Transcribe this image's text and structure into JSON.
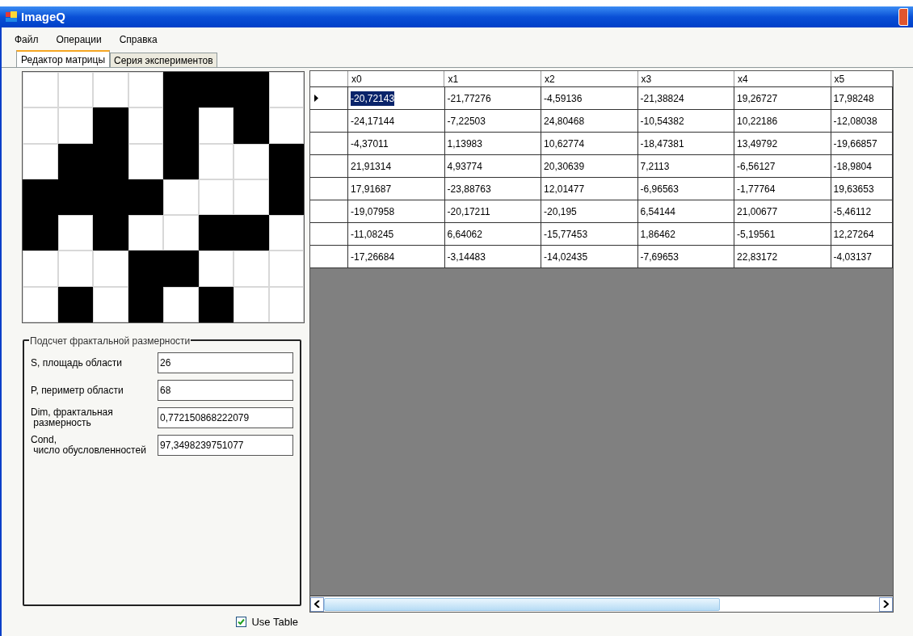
{
  "window": {
    "title": "ImageQ"
  },
  "menu": [
    "Файл",
    "Операции",
    "Справка"
  ],
  "tabs": [
    {
      "label": "Редактор матрицы",
      "selected": true
    },
    {
      "label": "Серия экспериментов",
      "selected": false
    }
  ],
  "matrix": [
    [
      false,
      false,
      false,
      false,
      true,
      true,
      true,
      false
    ],
    [
      false,
      false,
      true,
      false,
      true,
      false,
      true,
      false
    ],
    [
      false,
      true,
      true,
      false,
      true,
      false,
      false,
      true
    ],
    [
      true,
      true,
      true,
      true,
      false,
      false,
      false,
      true
    ],
    [
      true,
      false,
      true,
      false,
      false,
      true,
      true,
      false
    ],
    [
      false,
      false,
      false,
      true,
      true,
      false,
      false,
      false
    ],
    [
      false,
      true,
      false,
      true,
      false,
      true,
      false,
      false
    ]
  ],
  "group": {
    "title": "Подсчет фрактальной размерности",
    "fields": [
      {
        "label": "S, площадь области",
        "value": "26"
      },
      {
        "label": "P, периметр области",
        "value": "68"
      },
      {
        "label": "Dim, фрактальная\n размерность",
        "value": "0,772150868222079"
      },
      {
        "label": "Cond,\n число обусловленностей",
        "value": "97,3498239751077"
      }
    ]
  },
  "use_table": {
    "label": "Use Table",
    "checked": true
  },
  "table": {
    "columns": [
      "x0",
      "x1",
      "x2",
      "x3",
      "x4",
      "x5"
    ],
    "rows": [
      {
        "selected": true,
        "cells": [
          "-20,72143",
          "-21,77276",
          "-4,59136",
          "-21,38824",
          "19,26727",
          "17,98248"
        ]
      },
      {
        "selected": false,
        "cells": [
          "-24,17144",
          "-7,22503",
          "24,80468",
          "-10,54382",
          "10,22186",
          "-12,08038"
        ]
      },
      {
        "selected": false,
        "cells": [
          "-4,37011",
          "1,13983",
          "10,62774",
          "-18,47381",
          "13,49792",
          "-19,66857"
        ]
      },
      {
        "selected": false,
        "cells": [
          "21,91314",
          "4,93774",
          "20,30639",
          "7,2113",
          "-6,56127",
          "-18,9804"
        ]
      },
      {
        "selected": false,
        "cells": [
          "17,91687",
          "-23,88763",
          "12,01477",
          "-6,96563",
          "-1,77764",
          "19,63653"
        ]
      },
      {
        "selected": false,
        "cells": [
          "-19,07958",
          "-20,17211",
          "-20,195",
          "6,54144",
          "21,00677",
          "-5,46112"
        ]
      },
      {
        "selected": false,
        "cells": [
          "-11,08245",
          "6,64062",
          "-15,77453",
          "1,86462",
          "-5,19561",
          "12,27264"
        ]
      },
      {
        "selected": false,
        "cells": [
          "-17,26684",
          "-3,14483",
          "-14,02435",
          "-7,69653",
          "22,83172",
          "-4,03137"
        ]
      }
    ]
  }
}
